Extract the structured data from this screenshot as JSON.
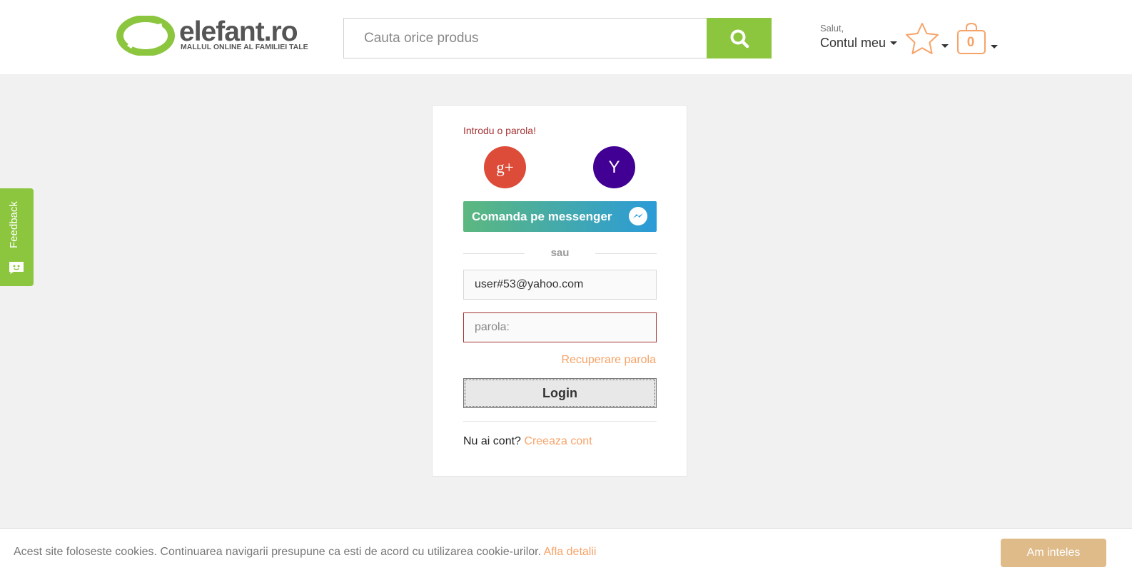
{
  "header": {
    "logo_name": "elefant.ro",
    "logo_tagline": "MALLUL ONLINE AL FAMILIEI TALE",
    "search_placeholder": "Cauta orice produs",
    "account_greeting": "Salut,",
    "account_label": "Contul meu",
    "cart_count": "0"
  },
  "feedback": {
    "label": "Feedback"
  },
  "login": {
    "error_message": "Introdu o parola!",
    "google_label": "g+",
    "yahoo_label": "Y",
    "messenger_label": "Comanda pe messenger",
    "separator": "sau",
    "email_value": "user#53@yahoo.com",
    "password_placeholder": "parola:",
    "recover_label": "Recuperare parola",
    "login_label": "Login",
    "no_account_text": "Nu ai cont?",
    "create_account_label": "Creeaza cont"
  },
  "cookie": {
    "text": "Acest site foloseste cookies. Continuarea navigarii presupune ca esti de acord cu utilizarea cookie-urilor.",
    "link_label": "Afla detalii",
    "button_label": "Am inteles"
  },
  "colors": {
    "brand_green": "#8cc63f",
    "accent_orange": "#f7a368",
    "error_red": "#a53434",
    "google_red": "#dd4b39",
    "yahoo_purple": "#410093",
    "cookie_button": "#dfbb8a"
  },
  "icons": {
    "search": "search-icon",
    "wishlist": "star-icon",
    "cart": "shopping-bag-icon",
    "messenger": "messenger-icon",
    "feedback": "chat-face-icon"
  }
}
